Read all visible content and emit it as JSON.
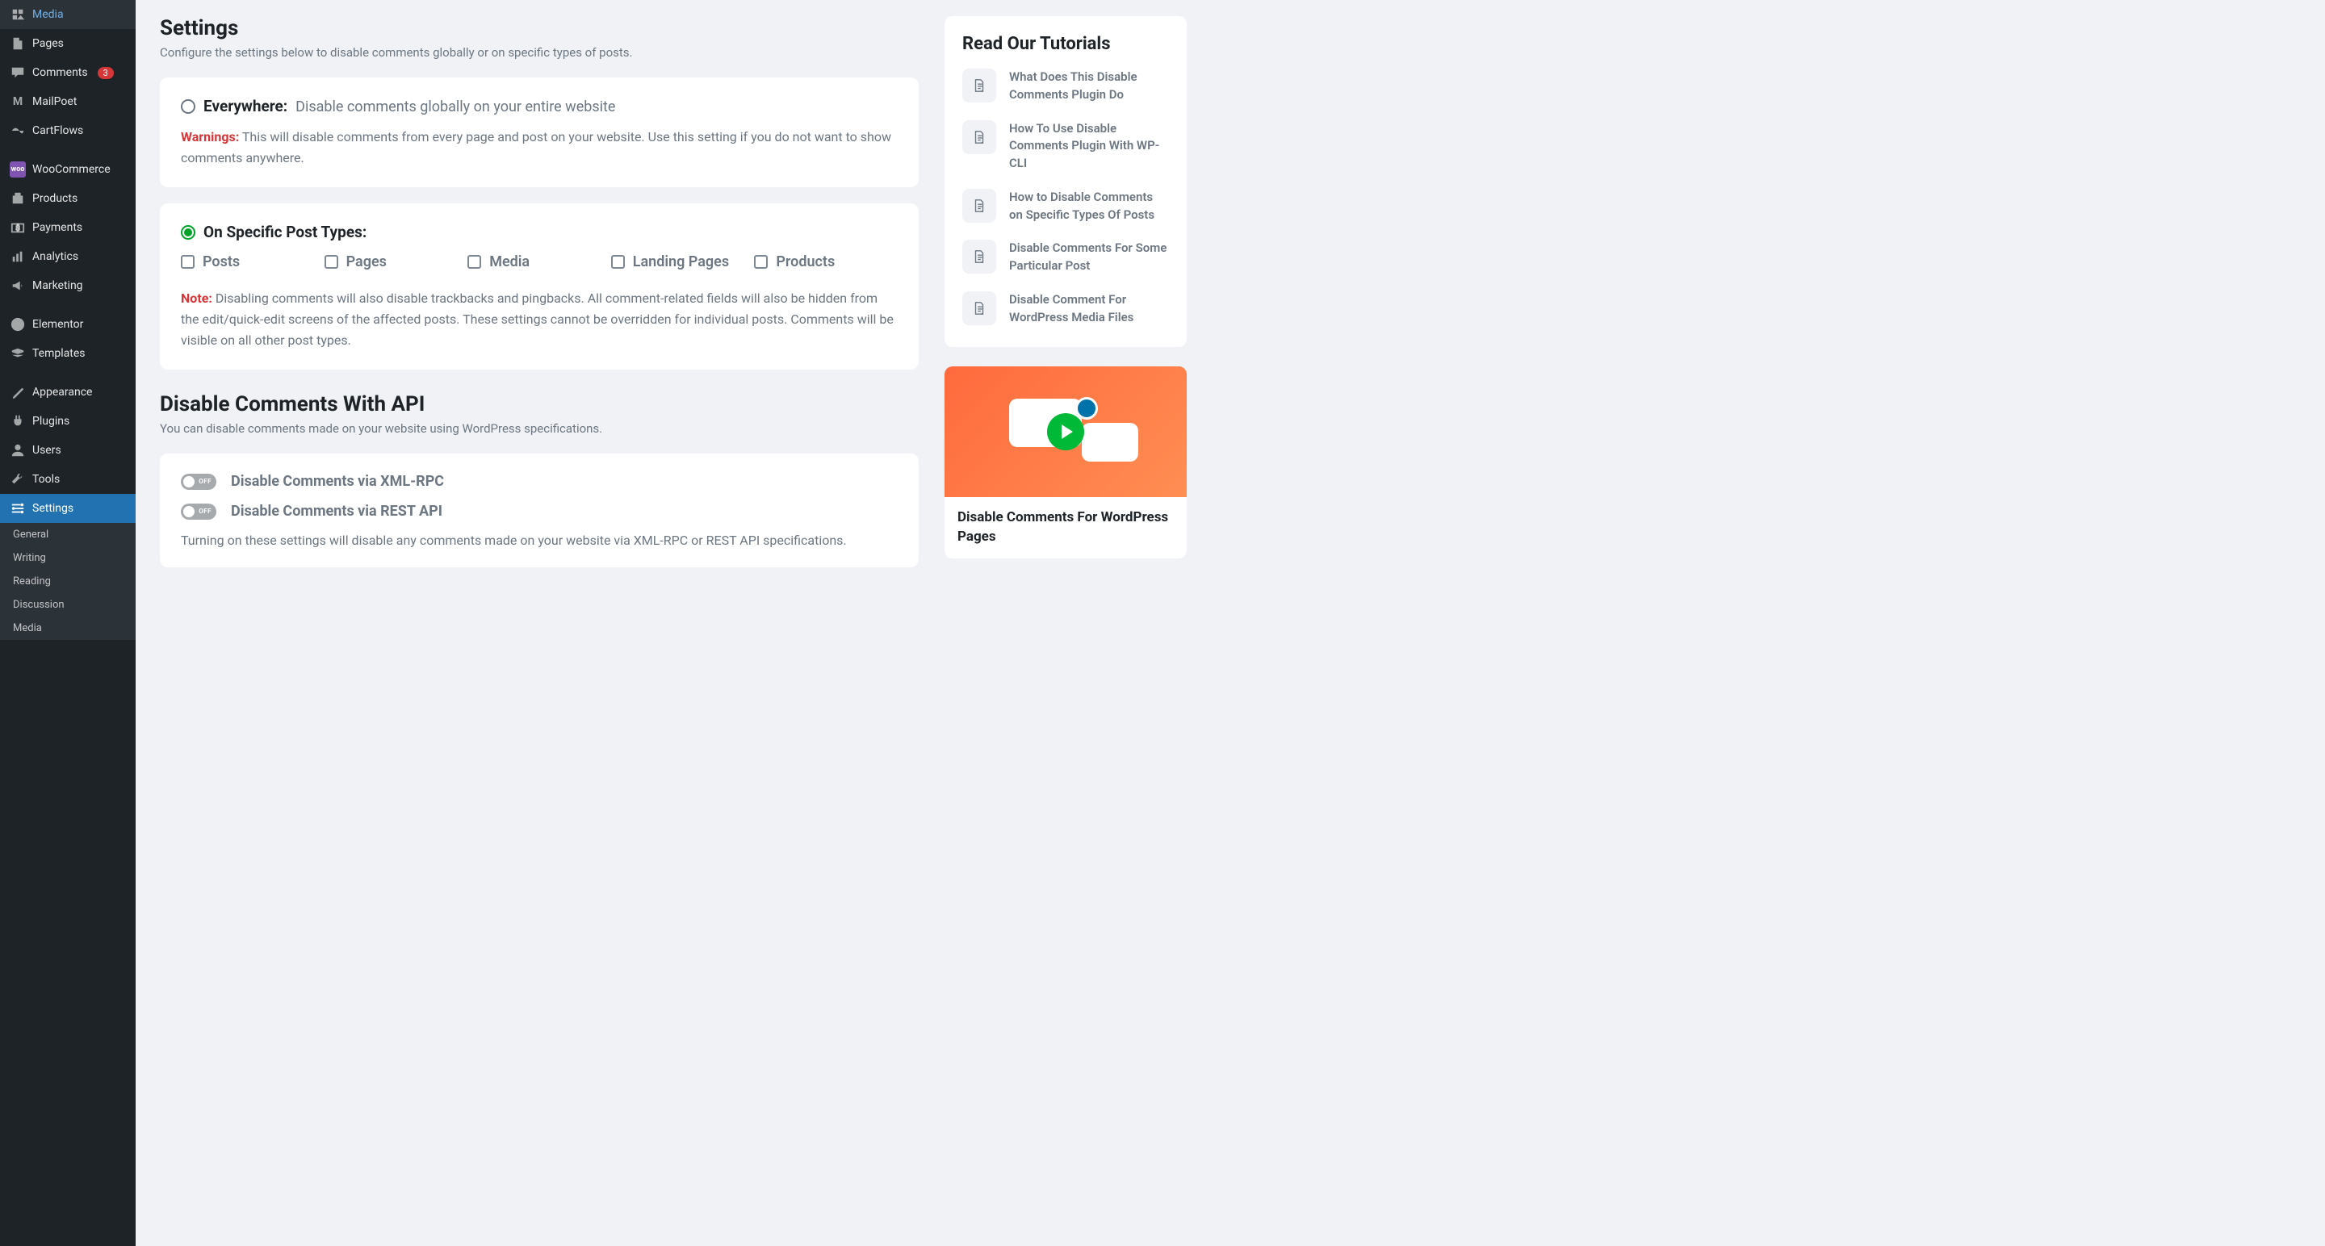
{
  "sidebar": {
    "items": [
      {
        "label": "Media",
        "icon": "media"
      },
      {
        "label": "Pages",
        "icon": "page"
      },
      {
        "label": "Comments",
        "icon": "comment",
        "badge": "3"
      },
      {
        "label": "MailPoet",
        "icon": "mailpoet"
      },
      {
        "label": "CartFlows",
        "icon": "cartflows"
      },
      {
        "label": "WooCommerce",
        "icon": "woo"
      },
      {
        "label": "Products",
        "icon": "products"
      },
      {
        "label": "Payments",
        "icon": "payments"
      },
      {
        "label": "Analytics",
        "icon": "analytics"
      },
      {
        "label": "Marketing",
        "icon": "marketing"
      },
      {
        "label": "Elementor",
        "icon": "elementor"
      },
      {
        "label": "Templates",
        "icon": "templates"
      },
      {
        "label": "Appearance",
        "icon": "appearance"
      },
      {
        "label": "Plugins",
        "icon": "plugins"
      },
      {
        "label": "Users",
        "icon": "users"
      },
      {
        "label": "Tools",
        "icon": "tools"
      },
      {
        "label": "Settings",
        "icon": "settings",
        "active": true
      }
    ],
    "sub": [
      "General",
      "Writing",
      "Reading",
      "Discussion",
      "Media"
    ]
  },
  "settings": {
    "title": "Settings",
    "desc": "Configure the settings below to disable comments globally or on specific types of posts.",
    "everywhere": {
      "label": "Everywhere:",
      "sublabel": "Disable comments globally on your entire website",
      "warn_label": "Warnings:",
      "warn_text": "This will disable comments from every page and post on your website. Use this setting if you do not want to show comments anywhere."
    },
    "specific": {
      "label": "On Specific Post Types:",
      "types": [
        "Posts",
        "Pages",
        "Media",
        "Landing Pages",
        "Products"
      ],
      "note_label": "Note:",
      "note_text": "Disabling comments will also disable trackbacks and pingbacks. All comment-related fields will also be hidden from the edit/quick-edit screens of the affected posts. These settings cannot be overridden for individual posts. Comments will be visible on all other post types."
    }
  },
  "api": {
    "title": "Disable Comments With API",
    "desc": "You can disable comments made on your website using WordPress specifications.",
    "toggles": [
      {
        "label": "Disable Comments via XML-RPC",
        "state": "OFF"
      },
      {
        "label": "Disable Comments via REST API",
        "state": "OFF"
      }
    ],
    "note": "Turning on these settings will disable any comments made on your website via XML-RPC or REST API specifications."
  },
  "tutorials": {
    "title": "Read Our Tutorials",
    "items": [
      "What Does This Disable Comments Plugin Do",
      "How To Use Disable Comments Plugin With WP-CLI",
      "How to Disable Comments on Specific Types Of Posts",
      "Disable Comments For Some Particular Post",
      "Disable Comment For WordPress Media Files"
    ]
  },
  "video": {
    "title": "Disable Comments For WordPress Pages"
  }
}
